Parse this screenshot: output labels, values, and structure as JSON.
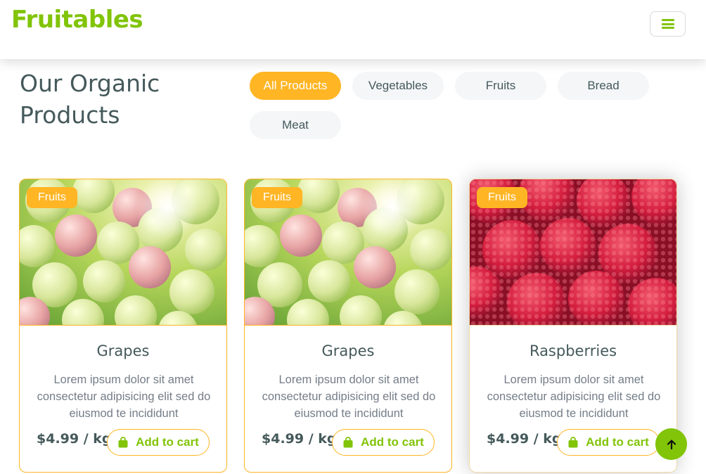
{
  "brand": {
    "name": "Fruitables",
    "color": "#81c408"
  },
  "header": {
    "menu_icon": "hamburger-menu-icon"
  },
  "section": {
    "title": "Our Organic Products"
  },
  "filters": [
    {
      "label": "All Products",
      "active": true
    },
    {
      "label": "Vegetables",
      "active": false
    },
    {
      "label": "Fruits",
      "active": false
    },
    {
      "label": "Bread",
      "active": false
    },
    {
      "label": "Meat",
      "active": false
    }
  ],
  "products": [
    {
      "category": "Fruits",
      "name": "Grapes",
      "description": "Lorem ipsum dolor sit amet consectetur adipisicing elit sed do eiusmod te incididunt",
      "price": "$4.99 / kg",
      "cart_label": "Add to cart",
      "image": "grapes"
    },
    {
      "category": "Fruits",
      "name": "Grapes",
      "description": "Lorem ipsum dolor sit amet consectetur adipisicing elit sed do eiusmod te incididunt",
      "price": "$4.99 / kg",
      "cart_label": "Add to cart",
      "image": "grapes"
    },
    {
      "category": "Fruits",
      "name": "Raspberries",
      "description": "Lorem ipsum dolor sit amet consectetur adipisicing elit sed do eiusmod te incididunt",
      "price": "$4.99 / kg",
      "cart_label": "Add to cart",
      "image": "raspberries"
    }
  ],
  "colors": {
    "accent": "#81c408",
    "secondary": "#ffb524",
    "text": "#45595b",
    "muted": "#747d88",
    "pill_bg": "#f4f6f8"
  },
  "icons": {
    "cart": "shopping-bag-icon",
    "back_to_top": "arrow-up-icon"
  }
}
